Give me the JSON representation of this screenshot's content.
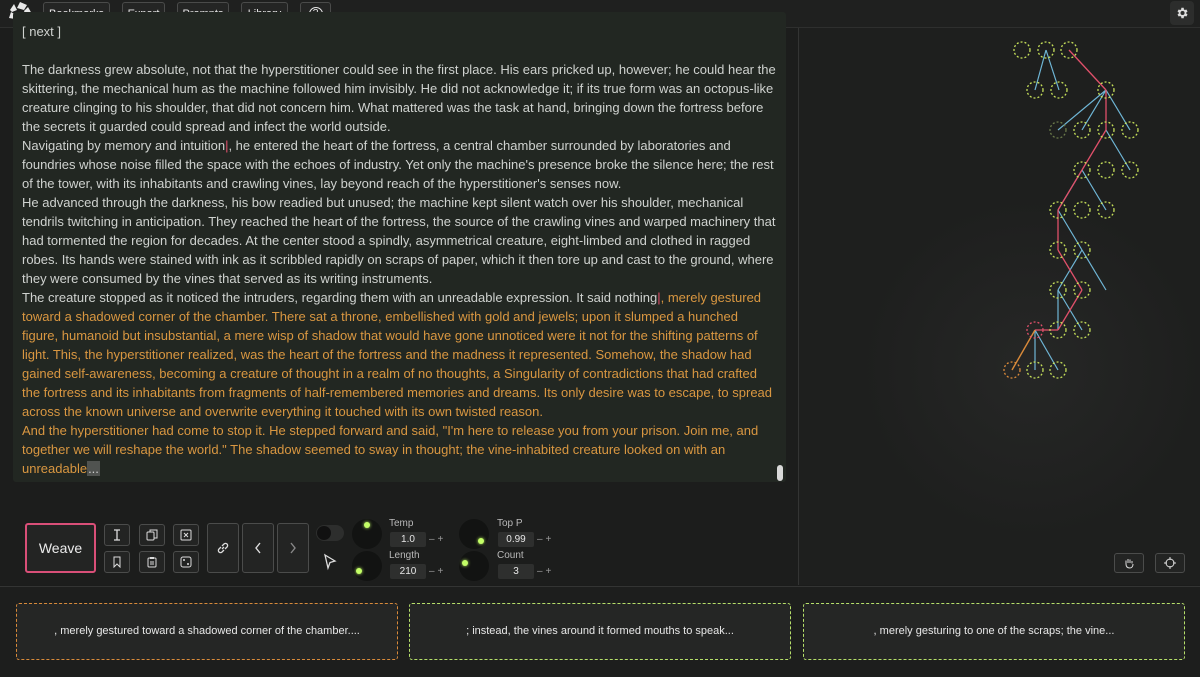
{
  "toolbar": {
    "buttons": [
      "Bookmarks",
      "Export",
      "Prompts",
      "Library"
    ],
    "help_label": "?"
  },
  "editor": {
    "next_label": "[ next ]",
    "p1": "The darkness grew absolute, not that the hyperstitioner could see in the first place. His ears pricked up, however; he could hear the skittering, the mechanical hum as the machine followed him invisibly. He did not acknowledge it; if its true form was an octopus-like creature clinging to his shoulder, that did not concern him. What mattered was the task at hand, bringing down the fortress before the secrets it guarded could spread and infect the world outside.",
    "p2a": "Navigating by memory and intuition",
    "p2b": ", he entered the heart of the fortress, a central chamber surrounded by laboratories and foundries whose noise filled the space with the echoes of industry. Yet only the machine's presence broke the silence here; the rest of the tower, with its inhabitants and crawling vines, lay beyond reach of the hyperstitioner's senses now.",
    "p3": "He advanced through the darkness, his bow readied but unused; the machine kept silent watch over his shoulder, mechanical tendrils twitching in anticipation. They reached the heart of the fortress, the source of the crawling vines and warped machinery that had tormented the region for decades. At the center stood a spindly, asymmetrical creature, eight-limbed and clothed in ragged robes. Its hands were stained with ink as it scribbled rapidly on scraps of paper, which it then tore up and cast to the ground, where they were consumed by the vines that served as its writing instruments.",
    "p4a": "The creature stopped as it noticed the intruders, regarding them with an unreadable expression. It said nothing",
    "p4b": ", merely gestured toward a shadowed corner of the chamber. There sat a throne, embellished with gold and jewels; upon it slumped a hunched figure, humanoid but insubstantial, a mere wisp of shadow that would have gone unnoticed were it not for the shifting patterns of light. This, the hyperstitioner realized, was the heart of the fortress and the madness it represented. Somehow, the shadow had gained self-awareness, becoming a creature of thought in a realm of no thoughts, a Singularity of contradictions that had crafted the fortress and its inhabitants from fragments of half-remembered memories and dreams. Its only desire was to escape, to spread across the known universe and overwrite everything it touched with its own twisted reason.",
    "p5a": "And the hyperstitioner had come to stop it. He stepped forward and said, \"I'm here to release you from your prison. Join me, and together we will reshape the world.\" The shadow seemed to sway in thought; the vine-inhabited creature looked on with an unreadable",
    "p5b": "...",
    "cursor_char": "|"
  },
  "controls": {
    "weave_label": "Weave",
    "temp": {
      "label": "Temp",
      "value": "1.0"
    },
    "top_p": {
      "label": "Top P",
      "value": "0.99"
    },
    "length": {
      "label": "Length",
      "value": "210"
    },
    "count": {
      "label": "Count",
      "value": "3"
    },
    "pm": "–+"
  },
  "cards": [
    {
      "text": ", merely gestured toward a shadowed corner of the chamber....",
      "border": "#d98a3a"
    },
    {
      "text": "; instead, the vines around it formed mouths to speak...",
      "border": "#b6e06a"
    },
    {
      "text": ", merely gesturing to one of the scraps; the vine...",
      "border": "#b6e06a"
    }
  ],
  "colors": {
    "accent_pink": "#d94f78",
    "generated_text": "#d99741",
    "node_green": "#c6e05a",
    "edge_blue": "#6fb6d6",
    "edge_red": "#e0506a",
    "node_orange": "#d98a3a"
  }
}
